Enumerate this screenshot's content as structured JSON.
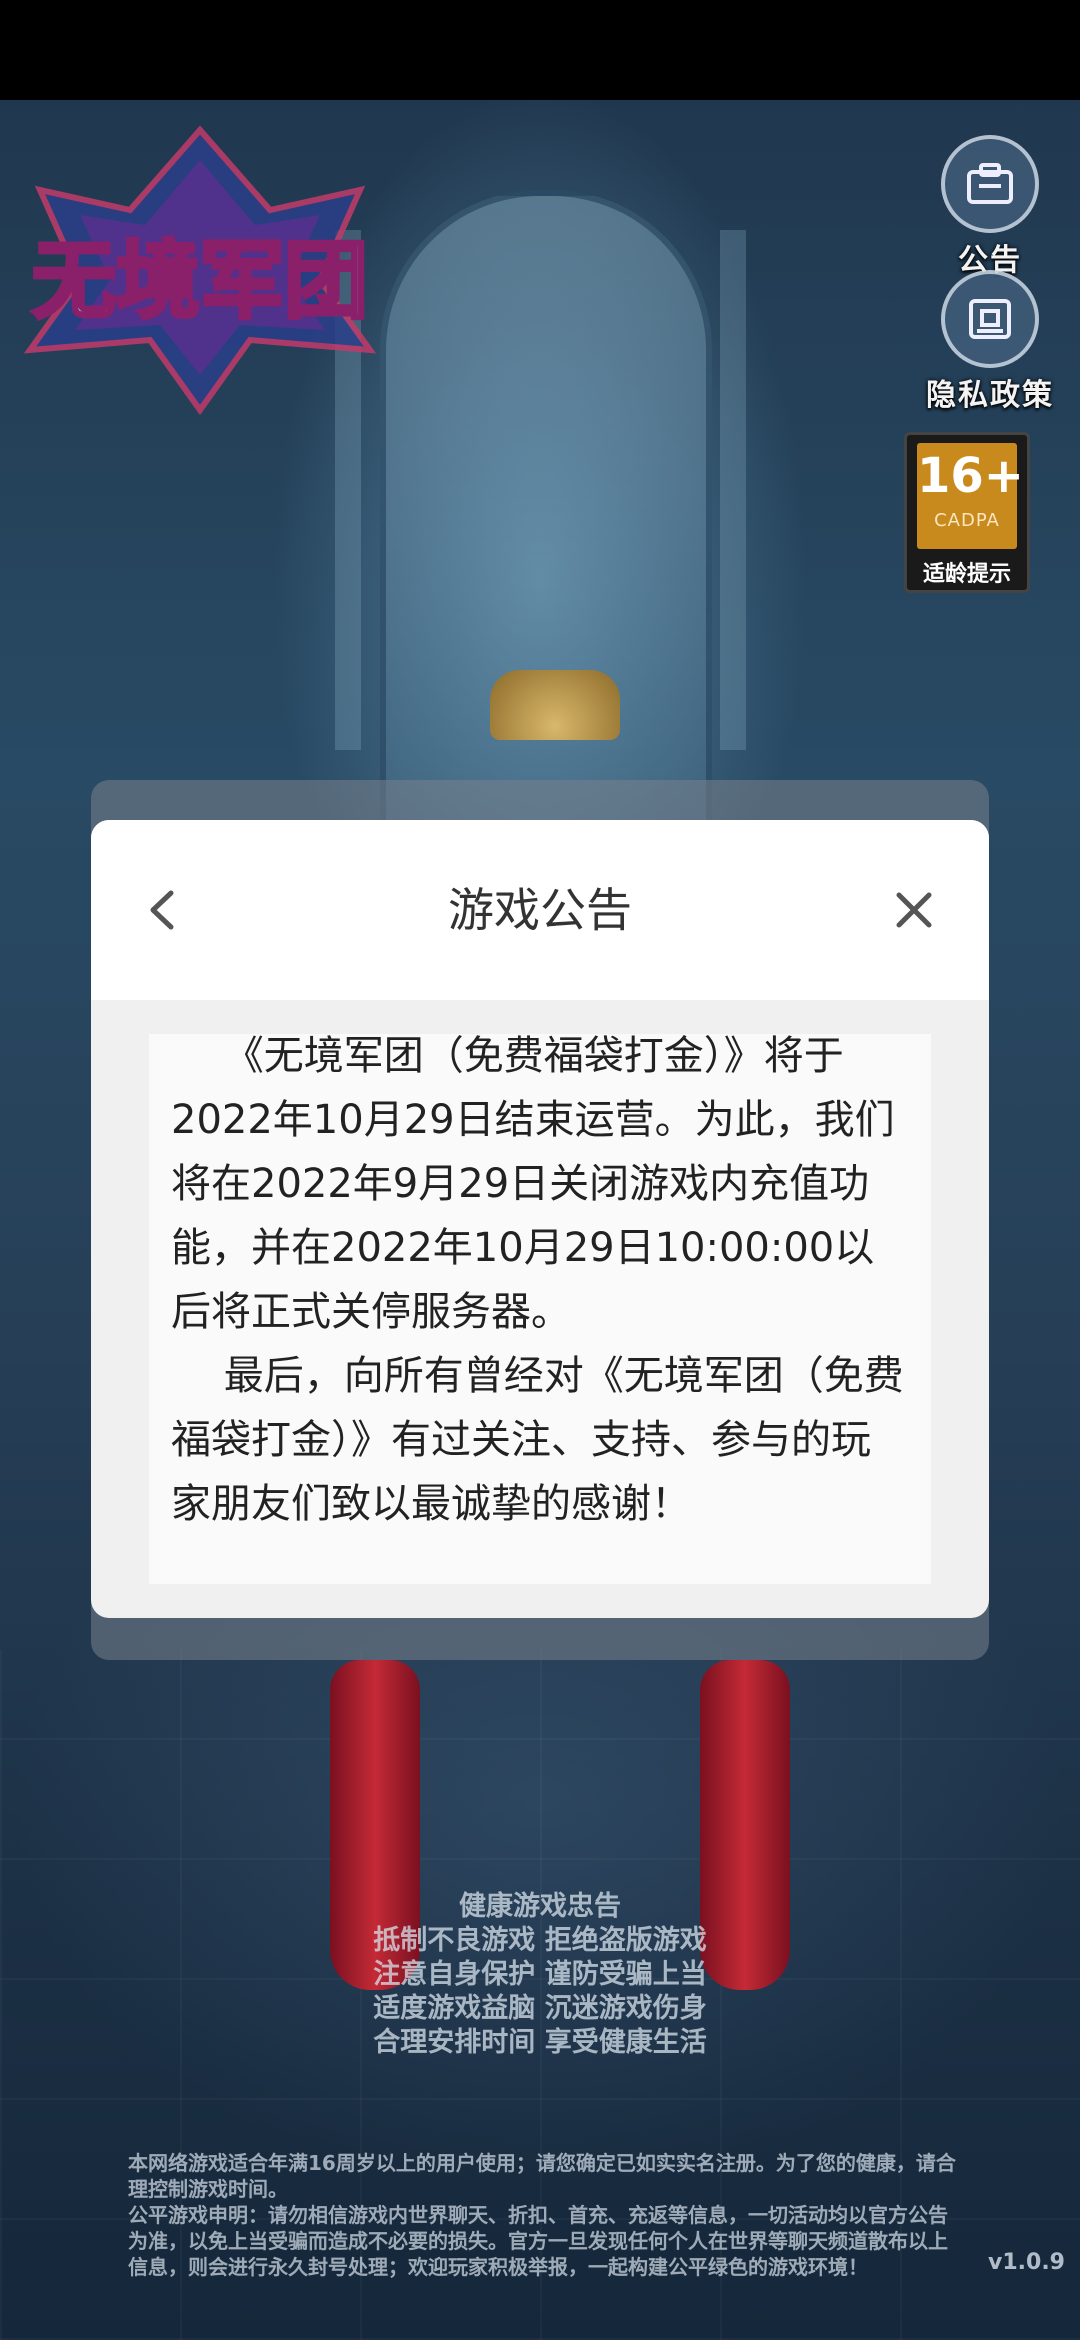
{
  "game": {
    "logo_text": "无境军团",
    "buttons": [
      {
        "label": "公告",
        "icon": "notice-icon"
      },
      {
        "label": "隐私政策",
        "icon": "privacy-icon"
      }
    ],
    "age_rating": {
      "age": "16+",
      "org": "CADPA",
      "tip": "适龄提示"
    },
    "health_advice": {
      "title": "健康游戏忠告",
      "lines": [
        "抵制不良游戏 拒绝盗版游戏",
        "注意自身保护 谨防受骗上当",
        "适度游戏益脑 沉迷游戏伤身",
        "合理安排时间 享受健康生活"
      ]
    },
    "disclaimer": [
      "本网络游戏适合年满16周岁以上的用户使用；请您确定已如实实名注册。为了您的健康，请合理控制游戏时间。",
      "公平游戏申明：请勿相信游戏内世界聊天、折扣、首充、充返等信息，一切活动均以官方公告为准，以免上当受骗而造成不必要的损失。官方一旦发现任何个人在世界等聊天频道散布以上信息，则会进行永久封号处理；欢迎玩家积极举报，一起构建公平绿色的游戏环境！"
    ],
    "version": "v1.0.9"
  },
  "dialog": {
    "title": "游戏公告",
    "back_icon": "chevron-left-icon",
    "close_icon": "close-icon",
    "paragraphs": [
      "《无境军团（免费福袋打金）》将于2022年10月29日结束运营。为此，我们将在2022年9月29日关闭游戏内充值功能，并在2022年10月29日10:00:00以后将正式关停服务器。",
      "最后，向所有曾经对《无境军团（免费福袋打金）》有过关注、支持、参与的玩家朋友们致以最诚挚的感谢！"
    ]
  }
}
